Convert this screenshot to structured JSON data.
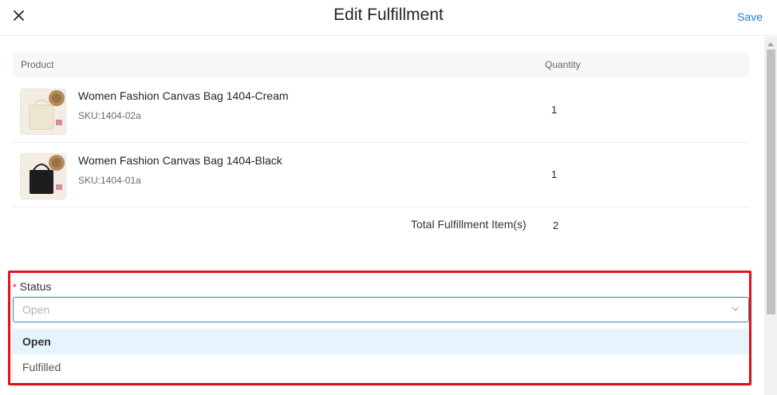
{
  "header": {
    "close_icon": "close-icon",
    "title": "Edit Fulfillment",
    "save_label": "Save"
  },
  "table": {
    "columns": [
      "Product",
      "Quantity"
    ],
    "rows": [
      {
        "name": "Women Fashion Canvas Bag 1404-Cream",
        "sku": "SKU:1404-02a",
        "quantity": "1",
        "image_color": "#efe6d2"
      },
      {
        "name": "Women Fashion Canvas Bag 1404-Black",
        "sku": "SKU:1404-01a",
        "quantity": "1",
        "image_color": "#1d1d1d"
      }
    ],
    "total_label": "Total Fulfillment Item(s)",
    "total_value": "2"
  },
  "status": {
    "label": "Status",
    "required_mark": "*",
    "selected": "Open",
    "options": [
      "Open",
      "Fulfilled"
    ],
    "highlight_color": "#e8101a"
  }
}
